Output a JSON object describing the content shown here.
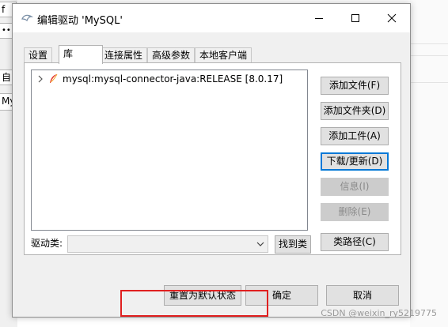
{
  "background": {
    "frag1": "f",
    "frag2": "••",
    "frag3": "自",
    "frag4": "My"
  },
  "dialog": {
    "title": "编辑驱动 'MySQL'",
    "tabs": [
      {
        "label": "设置"
      },
      {
        "label": "库"
      },
      {
        "label": "连接属性"
      },
      {
        "label": "高级参数"
      },
      {
        "label": "本地客户端"
      }
    ],
    "library_item": "mysql:mysql-connector-java:RELEASE [8.0.17]",
    "side_buttons": {
      "add_file": "添加文件(F)",
      "add_folder": "添加文件夹(D)",
      "add_artifact": "添加工件(A)",
      "download_update": "下载/更新(D)",
      "info": "信息(I)",
      "delete": "删除(E)",
      "class_path": "类路径(C)"
    },
    "driver_class_label": "驱动类:",
    "driver_class_value": "",
    "find_class": "找到类",
    "reset_default": "重置为默认状态",
    "ok": "确定",
    "cancel": "取消"
  },
  "watermark": "CSDN @weixin_ry5219775"
}
